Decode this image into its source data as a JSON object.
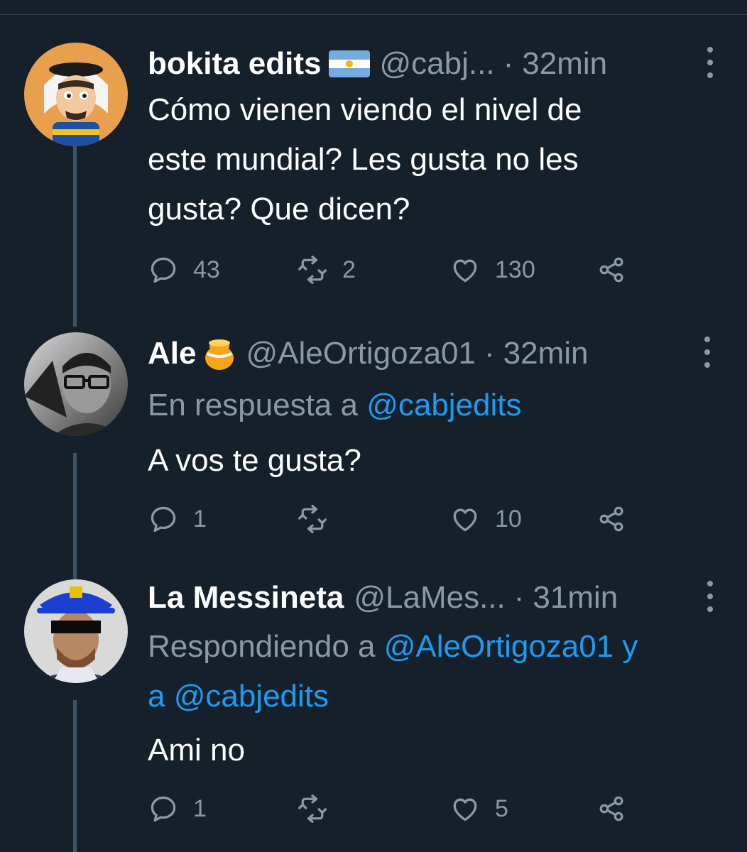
{
  "tweets": [
    {
      "author_name": "bokita edits",
      "author_emoji": "argentina-flag",
      "handle": "@cabj...",
      "separator": "·",
      "time": "32min",
      "text_lines": [
        "Cómo vienen viendo el nivel de",
        "este mundial? Les gusta no les",
        "gusta? Que dicen?"
      ],
      "replies": "43",
      "retweets": "2",
      "likes": "130"
    },
    {
      "author_name": "Ale",
      "author_emoji": "honey-pot",
      "handle": "@AleOrtigoza01",
      "separator": "·",
      "time": "32min",
      "reply_prefix": "En respuesta a ",
      "reply_mention": "@cabjedits",
      "text_lines": [
        "A vos te gusta?"
      ],
      "replies": "1",
      "retweets": "",
      "likes": "10"
    },
    {
      "author_name": "La Messineta",
      "handle": "@LaMes...",
      "separator": "·",
      "time": "31min",
      "reply_prefix": "Respondiendo a ",
      "reply_mention_1": "@AleOrtigoza01 y",
      "reply_line2_prefix": "a ",
      "reply_mention_2": "@cabjedits",
      "text_lines": [
        "Ami no"
      ],
      "replies": "1",
      "retweets": "",
      "likes": "5"
    }
  ],
  "colors": {
    "background": "#15202b",
    "secondary_text": "#8b98a5",
    "link": "#1d9bf0",
    "thread_line": "#3d5466"
  },
  "icons": [
    "reply-icon",
    "retweet-icon",
    "like-icon",
    "share-icon",
    "more-icon"
  ]
}
